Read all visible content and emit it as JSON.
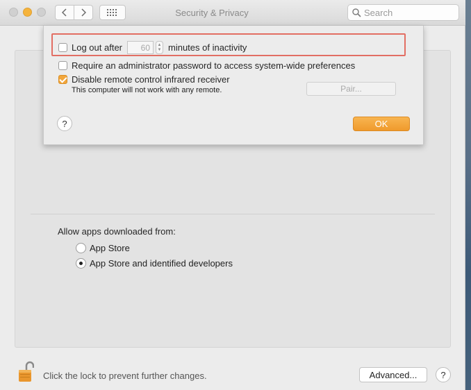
{
  "window": {
    "title": "Security & Privacy",
    "search": {
      "placeholder": "Search",
      "value": ""
    }
  },
  "sheet": {
    "logout": {
      "checked": false,
      "label_before": "Log out after",
      "minutes_value": "60",
      "label_after": "minutes of inactivity"
    },
    "require_admin": {
      "checked": false,
      "label": "Require an administrator password to access system-wide preferences"
    },
    "disable_ir": {
      "checked": true,
      "label": "Disable remote control infrared receiver",
      "subtext": "This computer will not work with any remote."
    },
    "pair_label": "Pair...",
    "help_label": "?",
    "ok_label": "OK"
  },
  "allow_apps": {
    "label": "Allow apps downloaded from:",
    "options": [
      {
        "label": "App Store",
        "selected": false
      },
      {
        "label": "App Store and identified developers",
        "selected": true
      }
    ]
  },
  "footer": {
    "lock_text": "Click the lock to prevent further changes.",
    "advanced_label": "Advanced...",
    "help_label": "?"
  },
  "colors": {
    "accent": "#f2a63b",
    "highlight": "#e26e63"
  }
}
